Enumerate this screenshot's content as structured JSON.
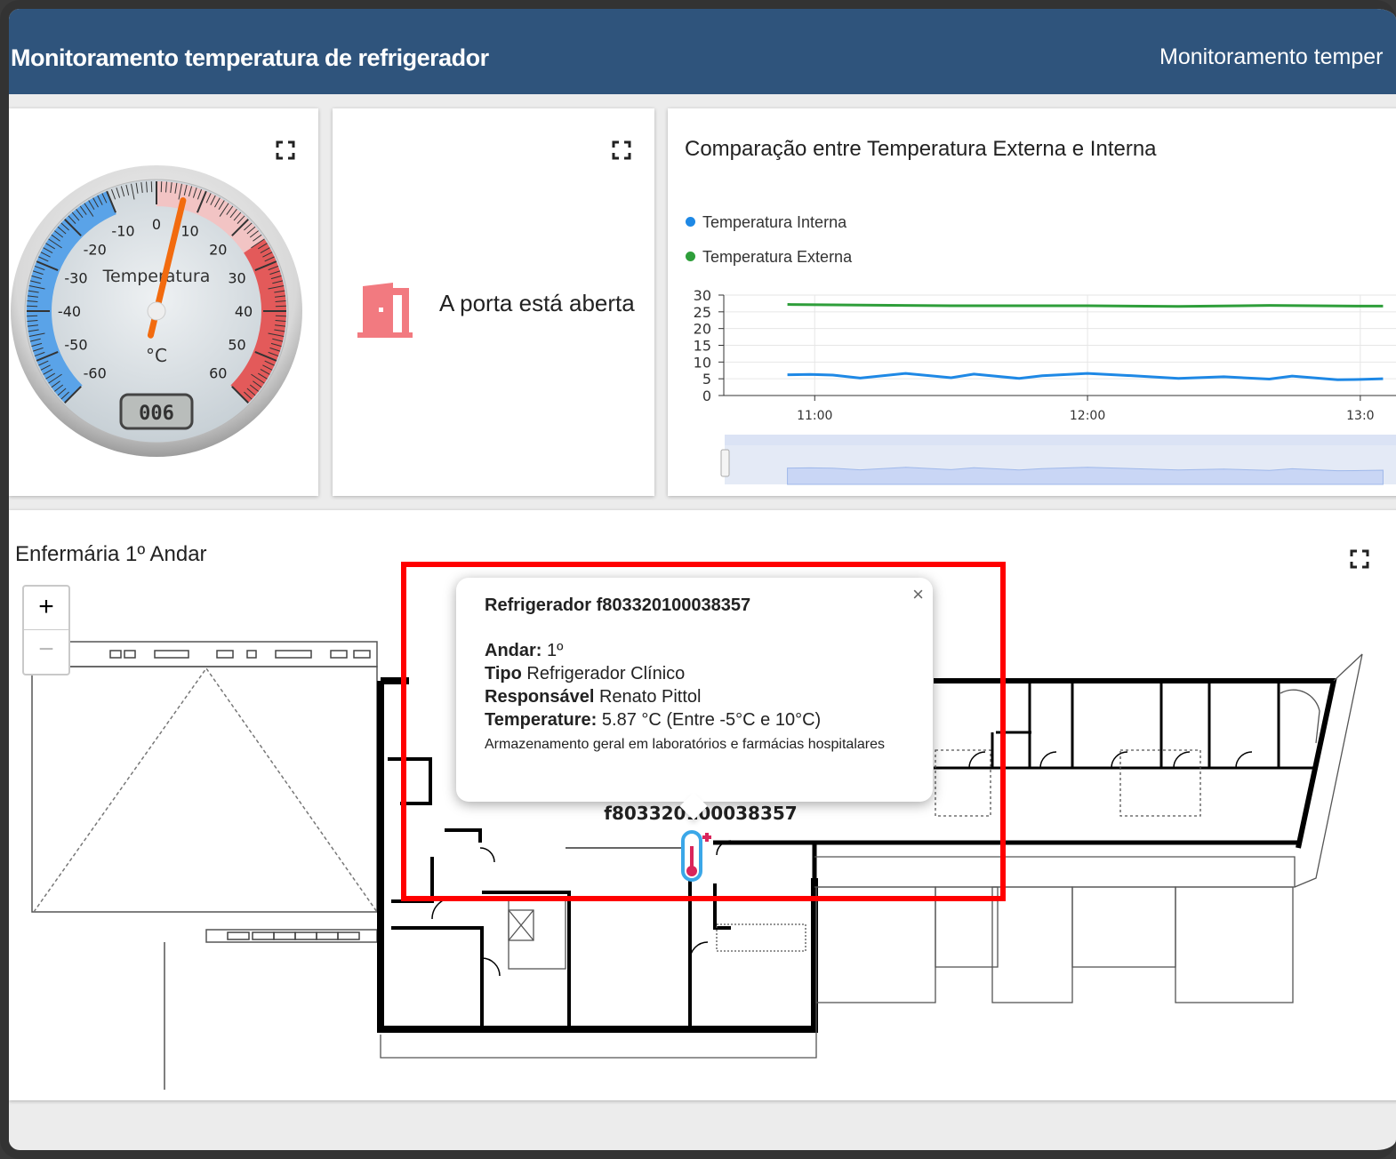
{
  "header": {
    "title": "Monitoramento temperatura de refrigerador",
    "title_right": "Monitoramento temper"
  },
  "gauge": {
    "label": "Temperatura",
    "unit": "°C",
    "value": 6,
    "display": "006",
    "min": -60,
    "max": 60,
    "ticks": [
      "-60",
      "-50",
      "-40",
      "-30",
      "-20",
      "-10",
      "0",
      "10",
      "20",
      "30",
      "40",
      "50",
      "60"
    ]
  },
  "door": {
    "status_text": "A porta está aberta",
    "icon": "door-open-icon",
    "icon_color": "#f27a80"
  },
  "chart": {
    "title": "Comparação entre Temperatura Externa e Interna",
    "legend": [
      {
        "name": "Temperatura Interna",
        "color": "#1e88e5"
      },
      {
        "name": "Temperatura Externa",
        "color": "#2e9e3a"
      }
    ]
  },
  "chart_data": {
    "type": "line",
    "title": "Comparação entre Temperatura Externa e Interna",
    "xlabel": "",
    "ylabel": "",
    "ylim": [
      0,
      30
    ],
    "yticks": [
      "30",
      "25",
      "20",
      "15",
      "10",
      "5",
      "0"
    ],
    "xticks": [
      "11:00",
      "12:00",
      "13:0"
    ],
    "grid": true,
    "legend_position": "top-left",
    "series": [
      {
        "name": "Temperatura Interna",
        "color": "#1e88e5",
        "x": [
          "10:54",
          "10:59",
          "11:04",
          "11:10",
          "11:20",
          "11:30",
          "11:35",
          "11:45",
          "11:50",
          "12:00",
          "12:10",
          "12:20",
          "12:30",
          "12:40",
          "12:45",
          "12:55",
          "13:00",
          "13:05"
        ],
        "y": [
          6.2,
          6.3,
          6.1,
          5.2,
          6.6,
          5.3,
          6.4,
          5.1,
          5.9,
          6.6,
          5.9,
          5.1,
          5.6,
          4.9,
          5.8,
          4.7,
          4.8,
          5.0
        ]
      },
      {
        "name": "Temperatura Externa",
        "color": "#2e9e3a",
        "x": [
          "10:54",
          "11:10",
          "11:30",
          "11:50",
          "12:00",
          "12:20",
          "12:40",
          "13:00",
          "13:05"
        ],
        "y": [
          27.2,
          27.0,
          26.8,
          26.8,
          26.8,
          26.6,
          26.9,
          26.7,
          26.7
        ]
      }
    ]
  },
  "map": {
    "title": "Enfermária 1º Andar",
    "zoom_in_label": "+",
    "zoom_out_label": "−",
    "marker_label": "f803320100038357",
    "popup": {
      "title": "Refrigerador f803320100038357",
      "andar_label": "Andar:",
      "andar_value": "1º",
      "tipo_label": "Tipo",
      "tipo_value": "Refrigerador Clínico",
      "resp_label": "Responsável",
      "resp_value": "Renato Pittol",
      "temp_label": "Temperature:",
      "temp_value": "5.87 °C (Entre -5°C e 10°C)",
      "description": "Armazenamento geral em laboratórios e farmácias hospitalares",
      "close_label": "×"
    }
  }
}
